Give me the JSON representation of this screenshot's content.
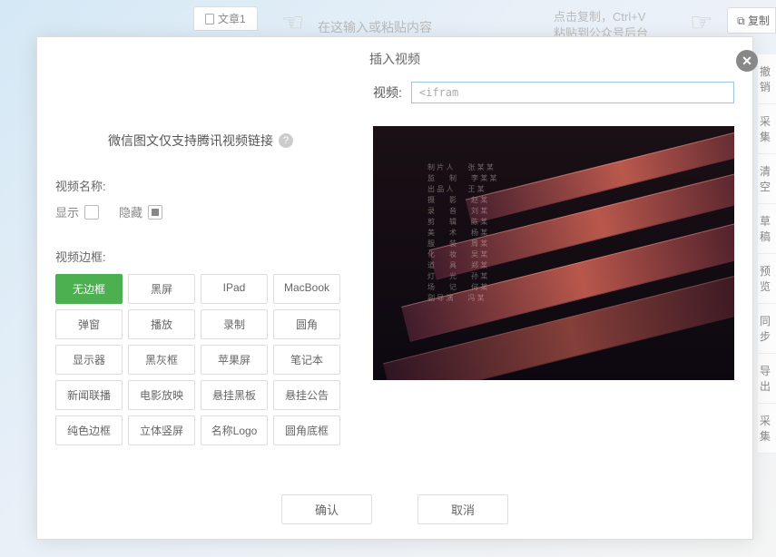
{
  "background": {
    "tab_label": "文章1",
    "input_hint": "在这输入或粘贴内容",
    "copy_hint": "点击复制，Ctrl+V\n粘贴到公众号后台",
    "copy_button": "复制",
    "sidebar_items": [
      "撤销",
      "采集",
      "清空",
      "草稿",
      "预览",
      "同步",
      "导出",
      "采集"
    ]
  },
  "modal": {
    "title": "插入视频",
    "support_note": "微信图文仅支持腾讯视频链接",
    "video_input_label": "视频:",
    "video_input_value": "<ifram",
    "video_name_label": "视频名称:",
    "show_label": "显示",
    "hide_label": "隐藏",
    "frame_label": "视频边框:",
    "frame_options": [
      "无边框",
      "黑屏",
      "IPad",
      "MacBook",
      "弹窗",
      "播放",
      "录制",
      "圆角",
      "显示器",
      "黑灰框",
      "苹果屏",
      "笔记本",
      "新闻联播",
      "电影放映",
      "悬挂黑板",
      "悬挂公告",
      "纯色边框",
      "立体竖屏",
      "名称Logo",
      "圆角底框"
    ],
    "frame_selected_index": 0,
    "confirm_label": "确认",
    "cancel_label": "取消"
  }
}
